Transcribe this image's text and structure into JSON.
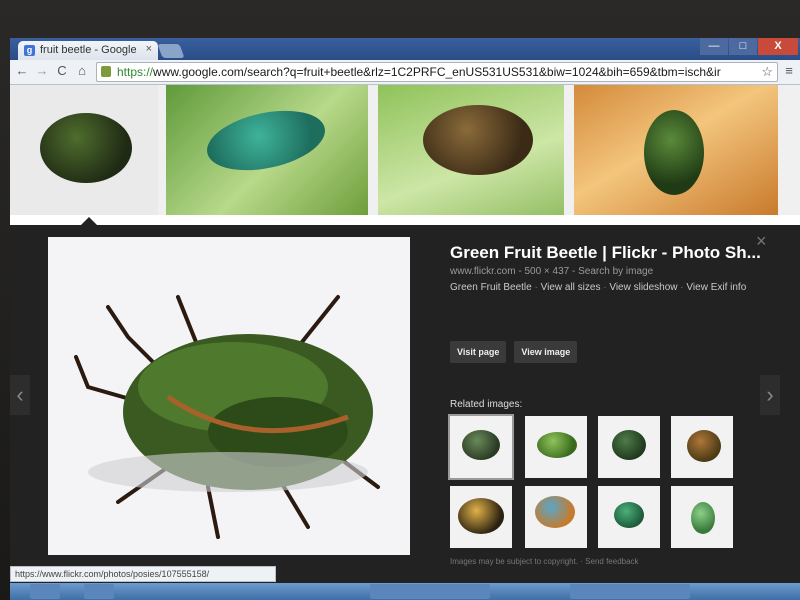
{
  "browser": {
    "tab_title": "fruit beetle - Google",
    "tab_close": "×",
    "favicon_letter": "g",
    "url_scheme": "https://",
    "url_rest": "www.google.com/search?q=fruit+beetle&rlz=1C2PRFC_enUS531US531&biw=1024&bih=659&tbm=isch&ir",
    "back": "←",
    "forward": "→",
    "reload": "C",
    "home": "⌂",
    "star": "☆",
    "menu": "≡",
    "win_min": "—",
    "win_max": "□",
    "win_close": "X"
  },
  "preview": {
    "title": "Green Fruit Beetle | Flickr - Photo Sh...",
    "meta": "www.flickr.com - 500 × 437 - Search by image",
    "links": [
      "Green Fruit Beetle",
      "View all sizes",
      "View slideshow",
      "View Exif info"
    ],
    "visit_page": "Visit page",
    "view_image": "View image",
    "related_label": "Related images:",
    "disclaimer": "Images may be subject to copyright. · Send feedback",
    "close": "×",
    "prev": "‹",
    "next": "›"
  },
  "status_url": "https://www.flickr.com/photos/posies/107555158/",
  "colors": {
    "accent": "#3a5f9e",
    "preview_bg": "#222222",
    "beetle_green": "#3f6a2a"
  }
}
